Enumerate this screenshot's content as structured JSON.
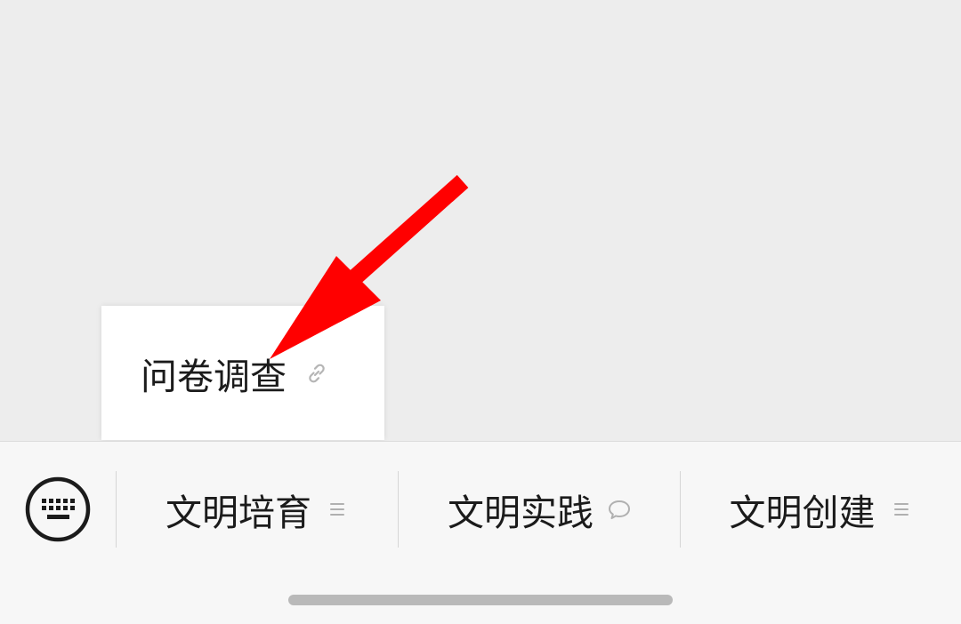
{
  "submenu": {
    "item_label": "问卷调查",
    "item_icon": "link-icon"
  },
  "menu_bar": {
    "keyboard_icon": "keyboard-icon",
    "items": [
      {
        "label": "文明培育",
        "icon": "menu-lines-icon"
      },
      {
        "label": "文明实践",
        "icon": "speech-bubble-icon"
      },
      {
        "label": "文明创建",
        "icon": "menu-lines-icon"
      }
    ]
  },
  "annotation": {
    "arrow_color": "#ff0000"
  },
  "colors": {
    "background": "#ededed",
    "menu_bar_bg": "#f7f7f7",
    "text": "#1b1b1b",
    "icon_gray": "#b0b0b0"
  }
}
